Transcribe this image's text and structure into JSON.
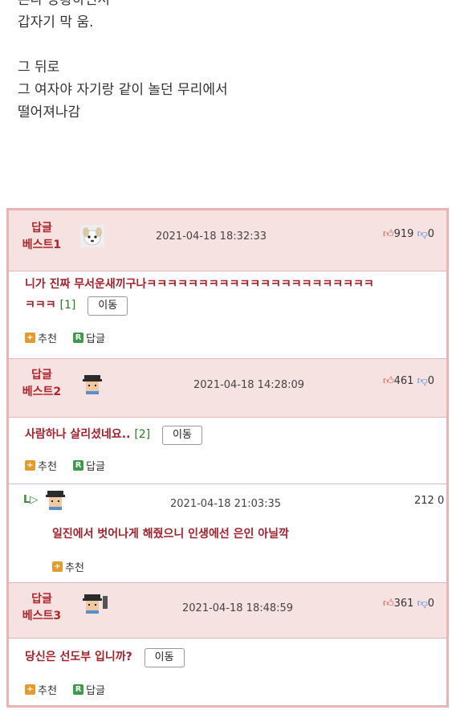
{
  "story": {
    "lines": [
      "본다 당황하면서",
      "갑자기 막 움.",
      "그 뒤로",
      "그 여자야 자기랑 같이 놀던 무리에서",
      "떨어져나감"
    ]
  },
  "comments": [
    {
      "best_label_1": "답글",
      "best_label_2": "베스트1",
      "avatar": "dog-avatar",
      "date": "2021-04-18 18:32:33",
      "up": "919",
      "down": "0",
      "text": "니가 진짜 무서운새끼구나ㅋㅋㅋㅋㅋㅋㅋㅋㅋㅋㅋㅋㅋㅋㅋㅋㅋㅋㅋㅋㅋㅋ",
      "text_line2": "ㅋㅋㅋ",
      "reply_count": "[1]",
      "move_label": "이동",
      "recommend_label": "추천",
      "reply_label": "답글"
    },
    {
      "best_label_1": "답글",
      "best_label_2": "베스트2",
      "avatar": "pixel-avatar",
      "date": "2021-04-18 14:28:09",
      "up": "461",
      "down": "0",
      "text": "사람하나 살리셨네요..",
      "reply_count": "[2]",
      "move_label": "이동",
      "recommend_label": "추천",
      "reply_label": "답글"
    },
    {
      "best_label_1": "답글",
      "best_label_2": "베스트3",
      "avatar": "pixel-avatar",
      "date": "2021-04-18 18:48:59",
      "up": "361",
      "down": "0",
      "text": "당신은 선도부 입니까?",
      "move_label": "이동",
      "recommend_label": "추천",
      "reply_label": "답글"
    }
  ],
  "reply": {
    "arrow": "L▷",
    "date": "2021-04-18 21:03:35",
    "votes": "212 0",
    "text": "일진에서 벗어나게 해줬으니 인생에선 은인 아닐깍",
    "recommend_label": "추천"
  },
  "colors": {
    "accent_red": "#b0252c",
    "header_bg": "#f7e2e2",
    "border": "#e8b4b4"
  }
}
